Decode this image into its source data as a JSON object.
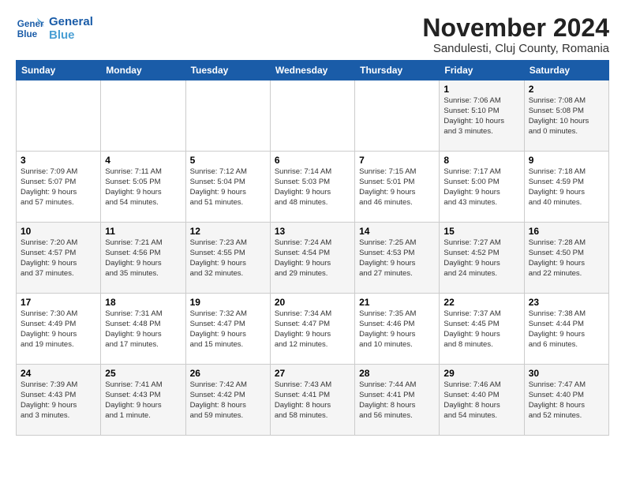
{
  "logo": {
    "line1": "General",
    "line2": "Blue"
  },
  "title": "November 2024",
  "subtitle": "Sandulesti, Cluj County, Romania",
  "headers": [
    "Sunday",
    "Monday",
    "Tuesday",
    "Wednesday",
    "Thursday",
    "Friday",
    "Saturday"
  ],
  "weeks": [
    [
      {
        "day": "",
        "info": ""
      },
      {
        "day": "",
        "info": ""
      },
      {
        "day": "",
        "info": ""
      },
      {
        "day": "",
        "info": ""
      },
      {
        "day": "",
        "info": ""
      },
      {
        "day": "1",
        "info": "Sunrise: 7:06 AM\nSunset: 5:10 PM\nDaylight: 10 hours\nand 3 minutes."
      },
      {
        "day": "2",
        "info": "Sunrise: 7:08 AM\nSunset: 5:08 PM\nDaylight: 10 hours\nand 0 minutes."
      }
    ],
    [
      {
        "day": "3",
        "info": "Sunrise: 7:09 AM\nSunset: 5:07 PM\nDaylight: 9 hours\nand 57 minutes."
      },
      {
        "day": "4",
        "info": "Sunrise: 7:11 AM\nSunset: 5:05 PM\nDaylight: 9 hours\nand 54 minutes."
      },
      {
        "day": "5",
        "info": "Sunrise: 7:12 AM\nSunset: 5:04 PM\nDaylight: 9 hours\nand 51 minutes."
      },
      {
        "day": "6",
        "info": "Sunrise: 7:14 AM\nSunset: 5:03 PM\nDaylight: 9 hours\nand 48 minutes."
      },
      {
        "day": "7",
        "info": "Sunrise: 7:15 AM\nSunset: 5:01 PM\nDaylight: 9 hours\nand 46 minutes."
      },
      {
        "day": "8",
        "info": "Sunrise: 7:17 AM\nSunset: 5:00 PM\nDaylight: 9 hours\nand 43 minutes."
      },
      {
        "day": "9",
        "info": "Sunrise: 7:18 AM\nSunset: 4:59 PM\nDaylight: 9 hours\nand 40 minutes."
      }
    ],
    [
      {
        "day": "10",
        "info": "Sunrise: 7:20 AM\nSunset: 4:57 PM\nDaylight: 9 hours\nand 37 minutes."
      },
      {
        "day": "11",
        "info": "Sunrise: 7:21 AM\nSunset: 4:56 PM\nDaylight: 9 hours\nand 35 minutes."
      },
      {
        "day": "12",
        "info": "Sunrise: 7:23 AM\nSunset: 4:55 PM\nDaylight: 9 hours\nand 32 minutes."
      },
      {
        "day": "13",
        "info": "Sunrise: 7:24 AM\nSunset: 4:54 PM\nDaylight: 9 hours\nand 29 minutes."
      },
      {
        "day": "14",
        "info": "Sunrise: 7:25 AM\nSunset: 4:53 PM\nDaylight: 9 hours\nand 27 minutes."
      },
      {
        "day": "15",
        "info": "Sunrise: 7:27 AM\nSunset: 4:52 PM\nDaylight: 9 hours\nand 24 minutes."
      },
      {
        "day": "16",
        "info": "Sunrise: 7:28 AM\nSunset: 4:50 PM\nDaylight: 9 hours\nand 22 minutes."
      }
    ],
    [
      {
        "day": "17",
        "info": "Sunrise: 7:30 AM\nSunset: 4:49 PM\nDaylight: 9 hours\nand 19 minutes."
      },
      {
        "day": "18",
        "info": "Sunrise: 7:31 AM\nSunset: 4:48 PM\nDaylight: 9 hours\nand 17 minutes."
      },
      {
        "day": "19",
        "info": "Sunrise: 7:32 AM\nSunset: 4:47 PM\nDaylight: 9 hours\nand 15 minutes."
      },
      {
        "day": "20",
        "info": "Sunrise: 7:34 AM\nSunset: 4:47 PM\nDaylight: 9 hours\nand 12 minutes."
      },
      {
        "day": "21",
        "info": "Sunrise: 7:35 AM\nSunset: 4:46 PM\nDaylight: 9 hours\nand 10 minutes."
      },
      {
        "day": "22",
        "info": "Sunrise: 7:37 AM\nSunset: 4:45 PM\nDaylight: 9 hours\nand 8 minutes."
      },
      {
        "day": "23",
        "info": "Sunrise: 7:38 AM\nSunset: 4:44 PM\nDaylight: 9 hours\nand 6 minutes."
      }
    ],
    [
      {
        "day": "24",
        "info": "Sunrise: 7:39 AM\nSunset: 4:43 PM\nDaylight: 9 hours\nand 3 minutes."
      },
      {
        "day": "25",
        "info": "Sunrise: 7:41 AM\nSunset: 4:43 PM\nDaylight: 9 hours\nand 1 minute."
      },
      {
        "day": "26",
        "info": "Sunrise: 7:42 AM\nSunset: 4:42 PM\nDaylight: 8 hours\nand 59 minutes."
      },
      {
        "day": "27",
        "info": "Sunrise: 7:43 AM\nSunset: 4:41 PM\nDaylight: 8 hours\nand 58 minutes."
      },
      {
        "day": "28",
        "info": "Sunrise: 7:44 AM\nSunset: 4:41 PM\nDaylight: 8 hours\nand 56 minutes."
      },
      {
        "day": "29",
        "info": "Sunrise: 7:46 AM\nSunset: 4:40 PM\nDaylight: 8 hours\nand 54 minutes."
      },
      {
        "day": "30",
        "info": "Sunrise: 7:47 AM\nSunset: 4:40 PM\nDaylight: 8 hours\nand 52 minutes."
      }
    ]
  ]
}
